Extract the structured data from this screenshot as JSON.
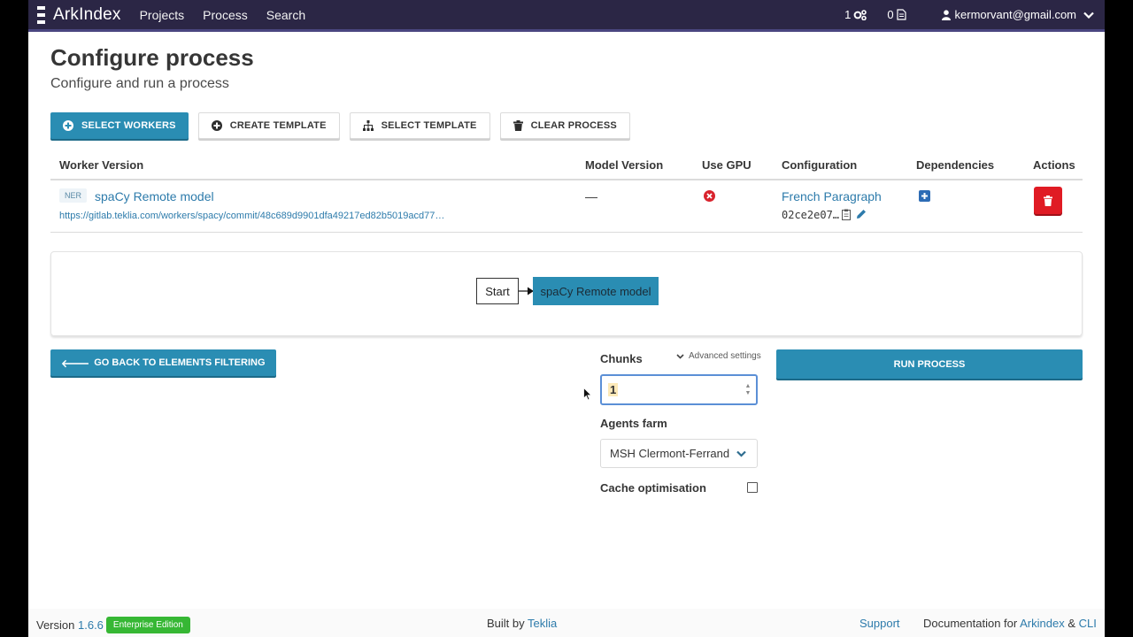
{
  "navbar": {
    "brand": "ArkIndex",
    "links": [
      "Projects",
      "Process",
      "Search"
    ],
    "tasks_count": "1",
    "files_count": "0",
    "user_email": "kermorvant@gmail.com"
  },
  "page": {
    "title": "Configure process",
    "subtitle": "Configure and run a process"
  },
  "toolbar": {
    "select_workers": "SELECT WORKERS",
    "create_template": "CREATE TEMPLATE",
    "select_template": "SELECT TEMPLATE",
    "clear_process": "CLEAR PROCESS"
  },
  "table": {
    "headers": [
      "Worker Version",
      "Model Version",
      "Use GPU",
      "Configuration",
      "Dependencies",
      "Actions"
    ],
    "rows": [
      {
        "tag": "NER",
        "worker_name": "spaCy Remote model",
        "worker_url": "https://gitlab.teklia.com/workers/spacy/commit/48c689d9901dfa49217ed82b5019acd77…",
        "model_version": "—",
        "configuration_name": "French Paragraph",
        "configuration_hash": "02ce2e07…"
      }
    ]
  },
  "graph": {
    "start_label": "Start",
    "worker_label": "spaCy Remote model"
  },
  "actions": {
    "back_button": "GO BACK TO ELEMENTS FILTERING",
    "chunks_label": "Chunks",
    "advanced_settings": "Advanced settings",
    "chunks_value": "1",
    "agents_farm_label": "Agents farm",
    "agents_farm_value": "MSH Clermont-Ferrand",
    "cache_label": "Cache optimisation",
    "run_button": "RUN PROCESS"
  },
  "footer": {
    "version_prefix": "Version",
    "version": "1.6.6",
    "edition": "Enterprise Edition",
    "built_by_prefix": "Built by",
    "built_by": "Teklia",
    "support": "Support",
    "docs_prefix": "Documentation for",
    "docs_arkindex": "Arkindex",
    "docs_amp": "&",
    "docs_cli": "CLI"
  },
  "colors": {
    "navbar_bg": "#2b2645",
    "primary": "#2a8db3",
    "link": "#2d7bab",
    "danger": "#e01b24",
    "success_badge": "#36b734"
  },
  "icons": [
    "brand-icon",
    "gears-icon",
    "file-icon",
    "user-icon",
    "chevron-down-icon",
    "plus-circle-icon",
    "sitemap-icon",
    "trash-icon",
    "times-circle-icon",
    "clipboard-icon",
    "pencil-icon",
    "plus-square-icon",
    "arrow-left-icon",
    "cursor-icon"
  ]
}
